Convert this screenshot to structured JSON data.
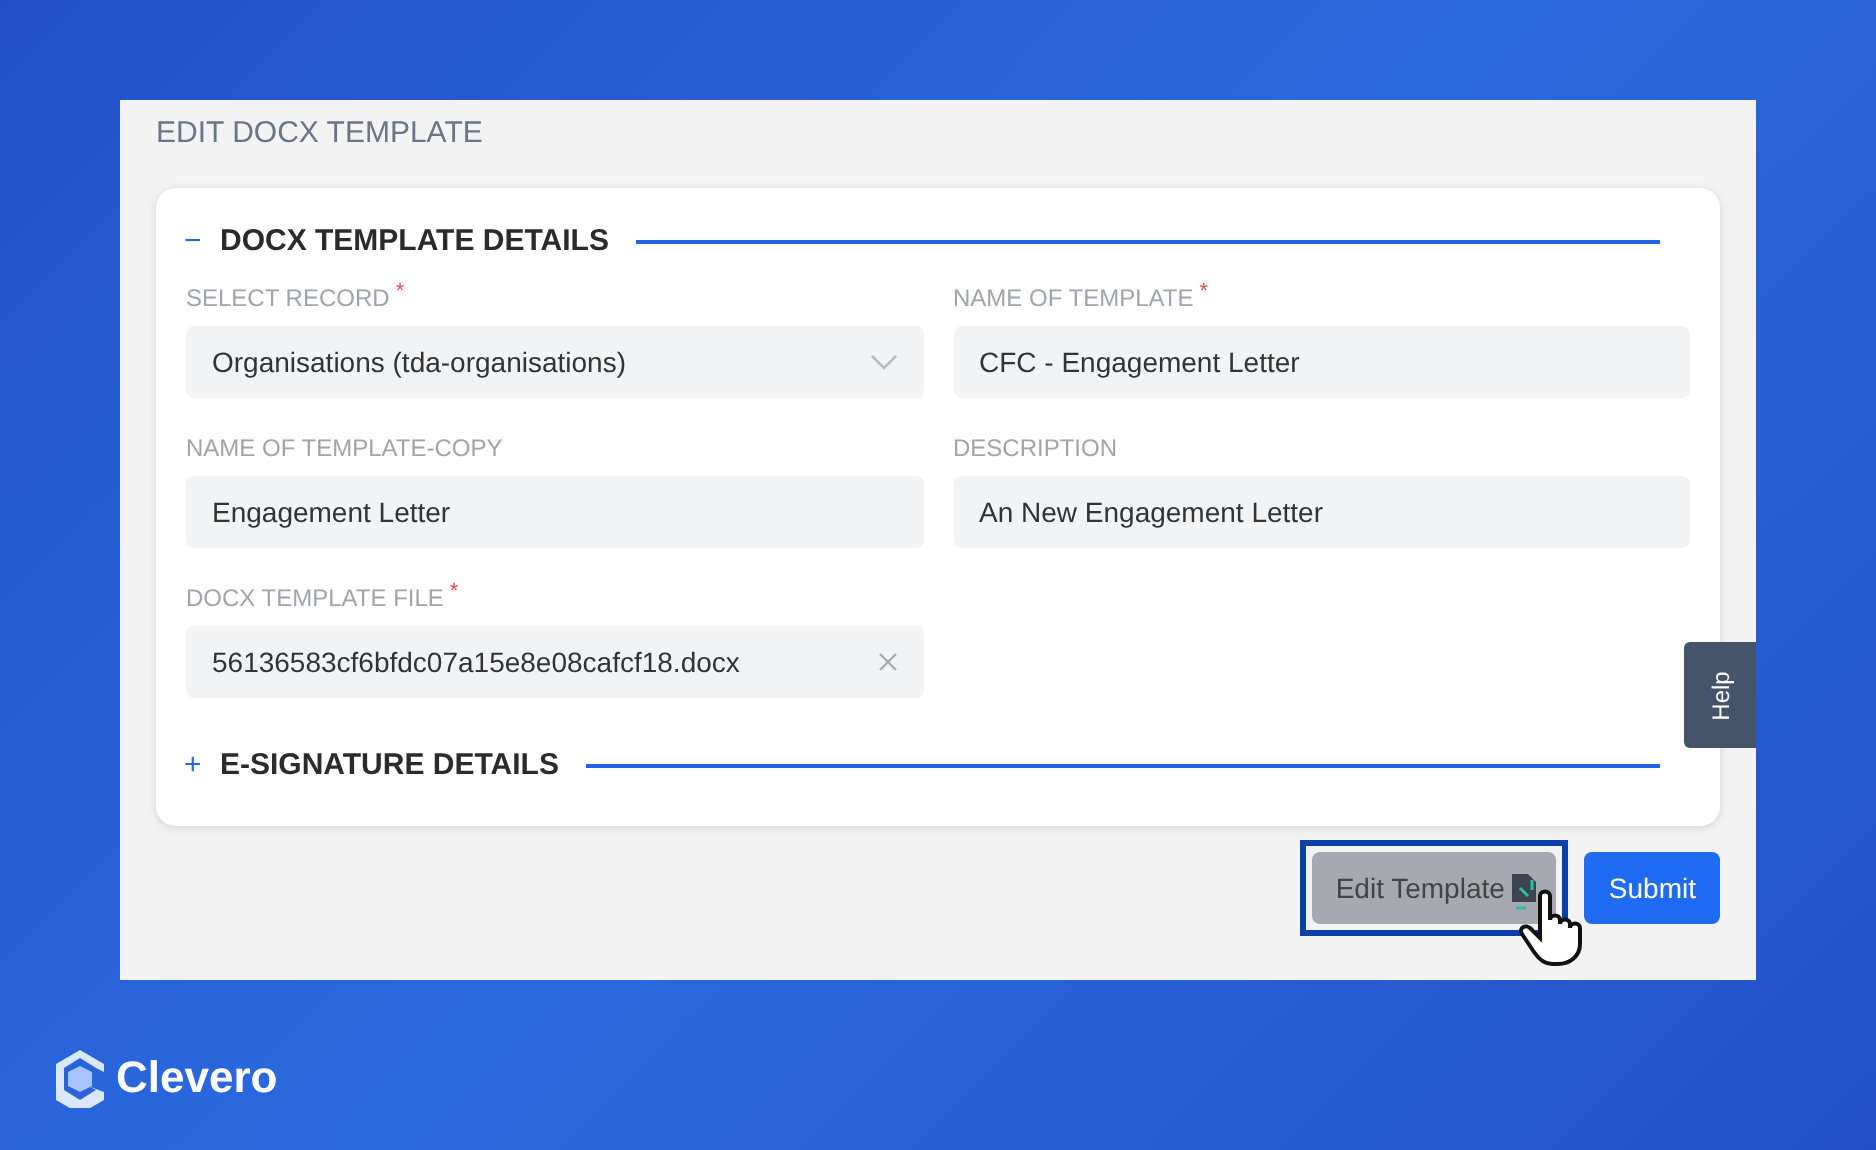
{
  "page_title": "EDIT DOCX TEMPLATE",
  "sections": [
    {
      "title": "DOCX TEMPLATE DETAILS",
      "toggle": "−",
      "fields": [
        {
          "kind": "select",
          "label": "SELECT RECORD",
          "required_mark": "*",
          "value": "Organisations (tda-organisations)"
        },
        {
          "kind": "text",
          "label": "NAME OF TEMPLATE",
          "required_mark": "*",
          "value": "CFC - Engagement Letter"
        },
        {
          "kind": "text",
          "label": "NAME OF TEMPLATE-COPY",
          "value": "Engagement Letter"
        },
        {
          "kind": "text",
          "label": "DESCRIPTION",
          "value": "An New Engagement Letter"
        },
        {
          "kind": "file",
          "label": "DOCX TEMPLATE FILE",
          "required_mark": "*",
          "value": "56136583cf6bfdc07a15e8e08cafcf18.docx"
        }
      ]
    },
    {
      "title": "E-SIGNATURE DETAILS",
      "toggle": "+"
    }
  ],
  "help_tab": "Help",
  "buttons": [
    {
      "kind": "secondary",
      "label": "Edit Template",
      "highlighted": true
    },
    {
      "kind": "primary",
      "label": "Submit",
      "highlighted": false
    }
  ],
  "brand": "Clevero"
}
